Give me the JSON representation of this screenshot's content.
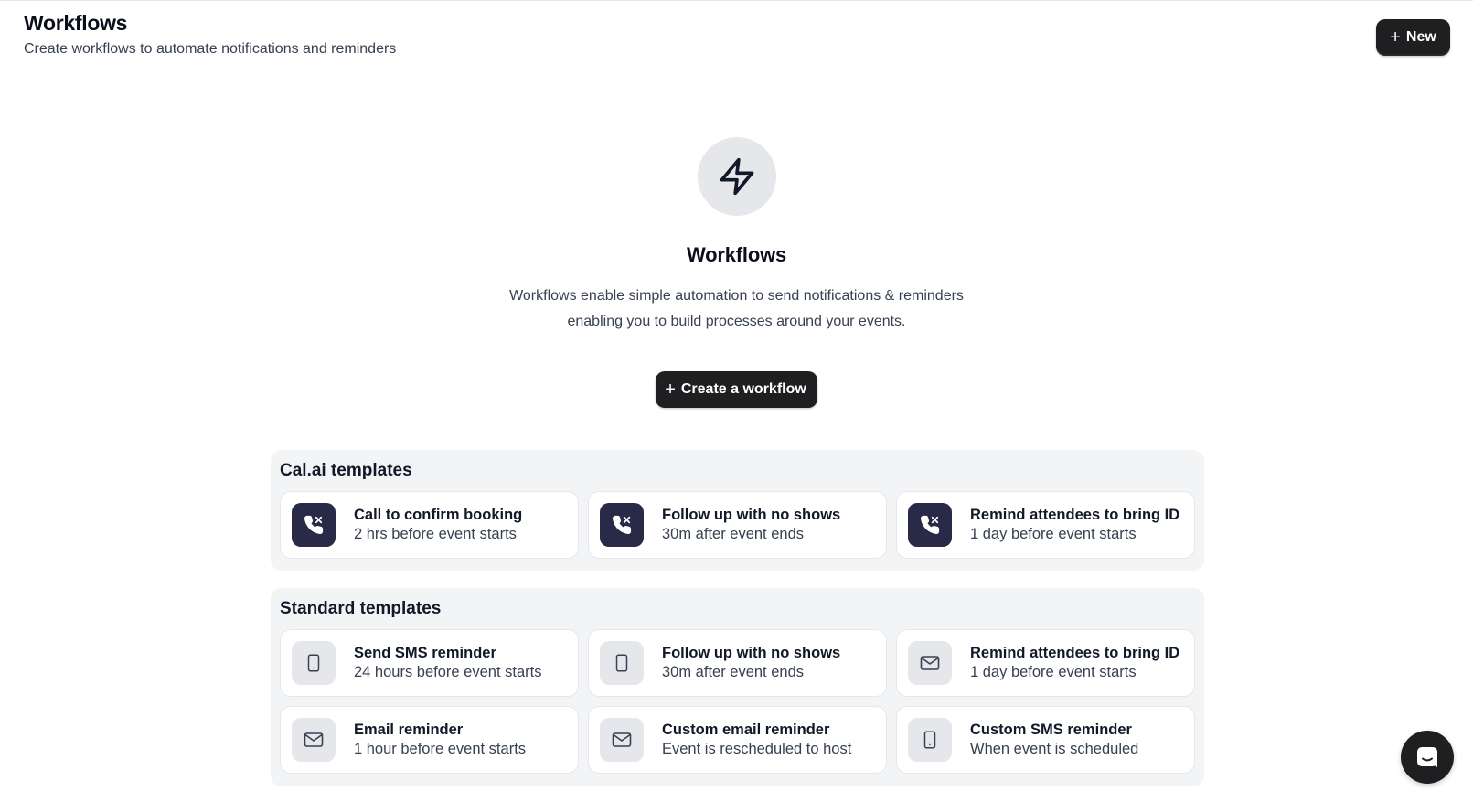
{
  "header": {
    "title": "Workflows",
    "subtitle": "Create workflows to automate notifications and reminders",
    "new_button": {
      "icon": "plus-icon",
      "label": "New"
    }
  },
  "empty_state": {
    "icon": "lightning-bolt-icon",
    "title": "Workflows",
    "description": "Workflows enable simple automation to send notifications & reminders enabling you to build processes around your events.",
    "create_button": {
      "icon": "plus-icon",
      "label": "Create a workflow"
    }
  },
  "calai_templates": {
    "title": "Cal.ai templates",
    "items": [
      {
        "icon": "phone-call-icon",
        "title": "Call to confirm booking",
        "subtitle": "2 hrs before event starts"
      },
      {
        "icon": "phone-call-icon",
        "title": "Follow up with no shows",
        "subtitle": "30m after event ends"
      },
      {
        "icon": "phone-call-icon",
        "title": "Remind attendees to bring ID",
        "subtitle": "1 day before event starts"
      }
    ]
  },
  "standard_templates": {
    "title": "Standard templates",
    "items": [
      {
        "icon": "smartphone-icon",
        "title": "Send SMS reminder",
        "subtitle": "24 hours before event starts"
      },
      {
        "icon": "smartphone-icon",
        "title": "Follow up with no shows",
        "subtitle": "30m after event ends"
      },
      {
        "icon": "mail-icon",
        "title": "Remind attendees to bring ID",
        "subtitle": "1 day before event starts"
      },
      {
        "icon": "mail-icon",
        "title": "Email reminder",
        "subtitle": "1 hour before event starts"
      },
      {
        "icon": "mail-icon",
        "title": "Custom email reminder",
        "subtitle": "Event is rescheduled to host"
      },
      {
        "icon": "smartphone-icon",
        "title": "Custom SMS reminder",
        "subtitle": "When event is scheduled"
      }
    ]
  },
  "chat_launcher": {
    "icon": "chat-bubble-icon"
  },
  "colors": {
    "primary_button": "#1f1f22",
    "calai_icon_bg": "#282a47",
    "standard_icon_bg": "#e5e7eb",
    "group_bg": "#f3f4f6"
  }
}
